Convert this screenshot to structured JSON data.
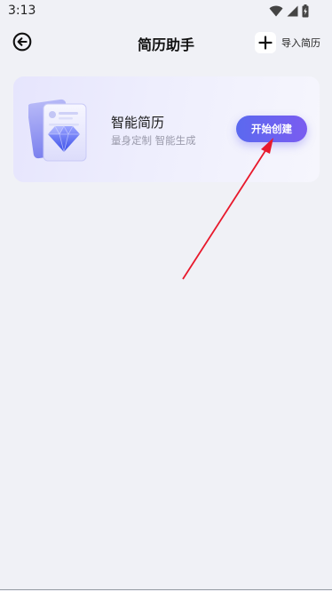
{
  "status_bar": {
    "time": "3:13"
  },
  "header": {
    "title": "简历助手",
    "import_label": "导入简历"
  },
  "card": {
    "title": "智能简历",
    "subtitle": "量身定制 智能生成",
    "start_label": "开始创建"
  },
  "icons": {
    "back": "back-arrow-circle-icon",
    "import": "plus-icon",
    "illustration": "resume-diamond-icon",
    "wifi": "wifi-icon",
    "signal": "signal-icon",
    "battery": "battery-charging-icon"
  },
  "colors": {
    "background": "#f0f1f6",
    "card_gradient_start": "#e6e5fd",
    "button_start": "#5b69ef",
    "button_end": "#7a5cf0",
    "arrow": "#e8192c"
  }
}
